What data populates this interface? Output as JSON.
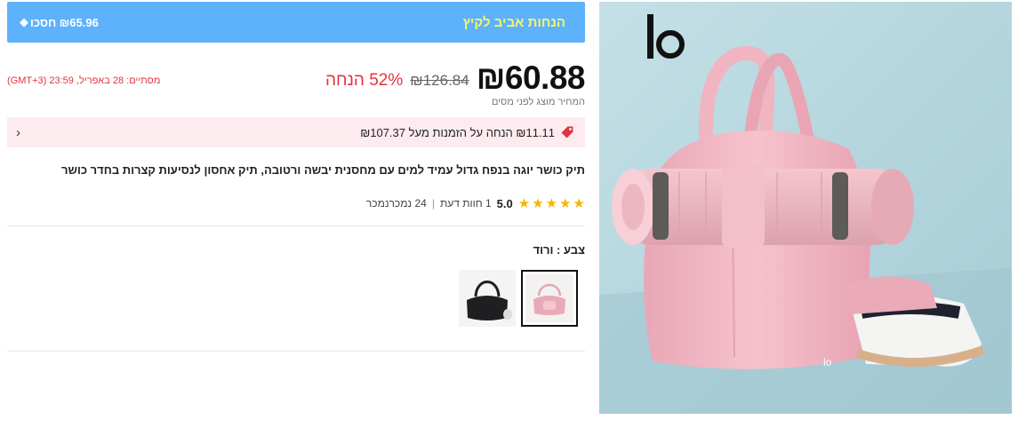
{
  "promo": {
    "title": "הנחות אביב לקיץ",
    "save_text": "₪65.96 חסכו",
    "save_icon": "diamond-icon",
    "background": "#5db2fb",
    "title_color": "#f9f56b"
  },
  "pricing": {
    "current_price": "₪60.88",
    "old_price": "₪126.84",
    "discount": "52% הנחה",
    "ends": "מסתיים: 28 באפריל, 23:59 (GMT+3)",
    "tax_note": "המחיר מוצג לפני מסים",
    "accent_color": "#e2333f"
  },
  "coupon": {
    "text": "₪11.11 הנחה על הזמנות מעל ₪107.37",
    "icon": "price-tag-icon",
    "chevron": "›"
  },
  "product": {
    "title": "תיק כושר יוגה בנפח גדול עמיד למים עם מחסנית יבשה ורטובה, תיק אחסון לנסיעות קצרות בחדר כושר",
    "rating": "5.0",
    "stars": 5,
    "reviews": "1 חוות דעת",
    "sold": "24 נמכרנמכר",
    "separator": "|"
  },
  "variants": {
    "label": "צבע : ורוד",
    "options": [
      {
        "name": "ורוד",
        "selected": true,
        "color": "#e8aab6"
      },
      {
        "name": "שחור",
        "selected": false,
        "color": "#1f1f22"
      }
    ]
  },
  "image": {
    "brand_mark": "lo",
    "bag_mark": "lo",
    "background": "#b6d7df",
    "bag_color": "#f2b8c4"
  }
}
